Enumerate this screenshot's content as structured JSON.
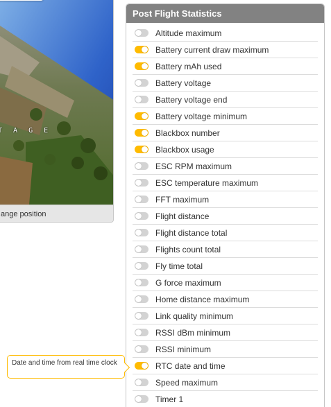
{
  "preview": {
    "osd_text": "T A G E",
    "footer_label": "ange position"
  },
  "stats_panel": {
    "title": "Post Flight Statistics",
    "accent_color": "#ffbb00",
    "items": [
      {
        "label": "Altitude maximum",
        "enabled": false
      },
      {
        "label": "Battery current draw maximum",
        "enabled": true
      },
      {
        "label": "Battery mAh used",
        "enabled": true
      },
      {
        "label": "Battery voltage",
        "enabled": false
      },
      {
        "label": "Battery voltage end",
        "enabled": false
      },
      {
        "label": "Battery voltage minimum",
        "enabled": true
      },
      {
        "label": "Blackbox number",
        "enabled": true
      },
      {
        "label": "Blackbox usage",
        "enabled": true
      },
      {
        "label": "ESC RPM maximum",
        "enabled": false
      },
      {
        "label": "ESC temperature maximum",
        "enabled": false
      },
      {
        "label": "FFT maximum",
        "enabled": false
      },
      {
        "label": "Flight distance",
        "enabled": false
      },
      {
        "label": "Flight distance total",
        "enabled": false
      },
      {
        "label": "Flights count total",
        "enabled": false
      },
      {
        "label": "Fly time total",
        "enabled": false
      },
      {
        "label": "G force maximum",
        "enabled": false
      },
      {
        "label": "Home distance maximum",
        "enabled": false
      },
      {
        "label": "Link quality minimum",
        "enabled": false
      },
      {
        "label": "RSSI dBm minimum",
        "enabled": false
      },
      {
        "label": "RSSI minimum",
        "enabled": false
      },
      {
        "label": "RTC date and time",
        "enabled": true
      },
      {
        "label": "Speed maximum",
        "enabled": false
      },
      {
        "label": "Timer 1",
        "enabled": false
      }
    ]
  },
  "tooltip": {
    "text": "Date and time from real time clock"
  }
}
